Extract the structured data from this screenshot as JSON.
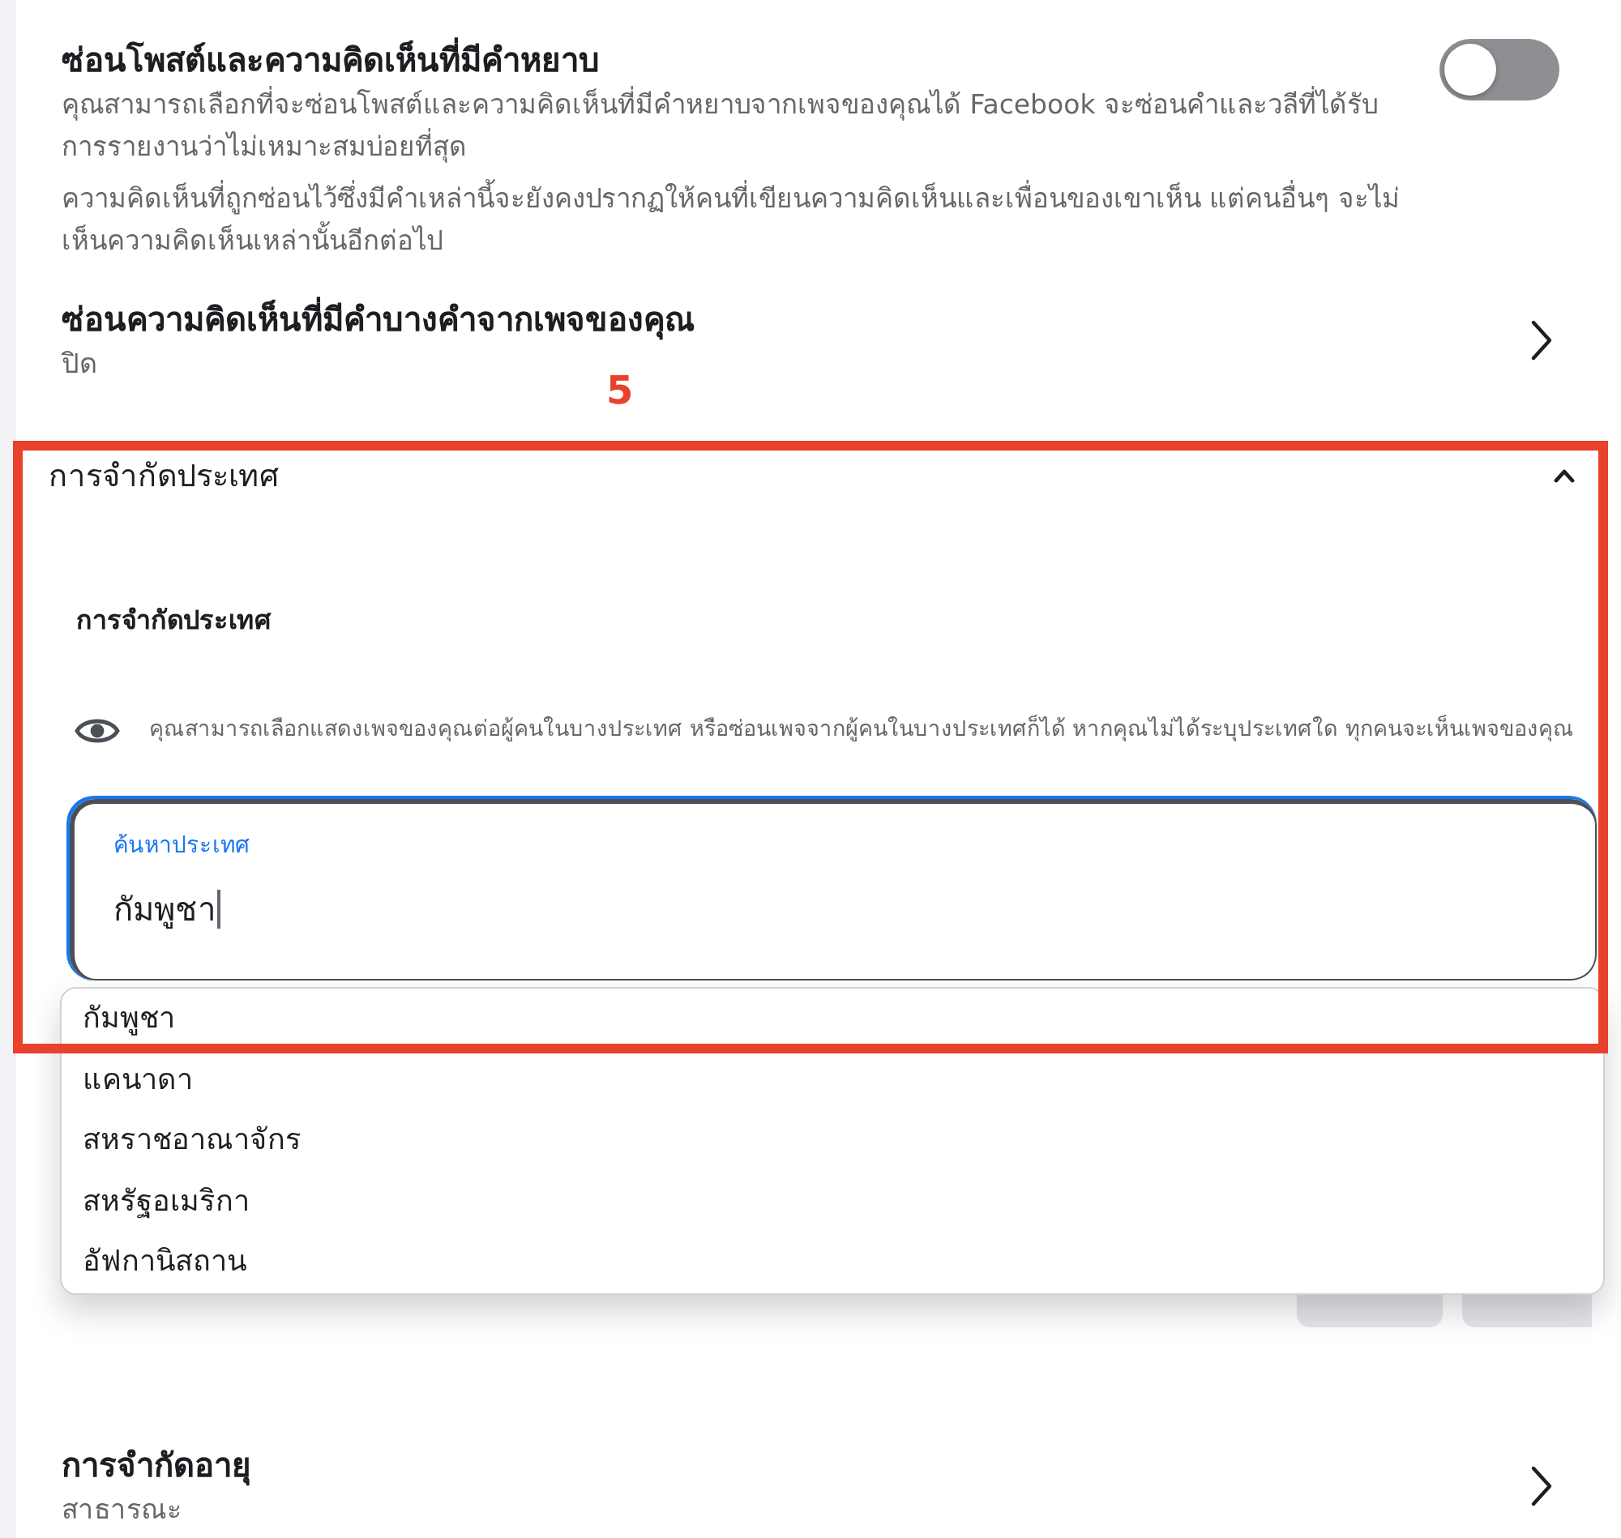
{
  "hide_profanity": {
    "title": "ซ่อนโพสต์และความคิดเห็นที่มีคำหยาบ",
    "description": [
      "คุณสามารถเลือกที่จะซ่อนโพสต์และความคิดเห็นที่มีคำหยาบจากเพจของคุณได้ Facebook จะซ่อนคำและวลีที่ได้รับการรายงานว่าไม่เหมาะสมบ่อยที่สุด",
      "ความคิดเห็นที่ถูกซ่อนไว้ซึ่งมีคำเหล่านี้จะยังคงปรากฏให้คนที่เขียนความคิดเห็นและเพื่อนของเขาเห็น แต่คนอื่นๆ จะไม่เห็นความคิดเห็นเหล่านั้นอีกต่อไป"
    ],
    "toggle": {
      "on": false
    }
  },
  "hide_words": {
    "title": "ซ่อนความคิดเห็นที่มีคำบางคำจากเพจของคุณ",
    "value": "ปิด"
  },
  "annotation": {
    "label": "5"
  },
  "country_restriction": {
    "header": "การจำกัดประเทศ",
    "expanded": true,
    "subheading": "การจำกัดประเทศ",
    "info": "คุณสามารถเลือกแสดงเพจของคุณต่อผู้คนในบางประเทศ หรือซ่อนเพจจากผู้คนในบางประเทศก็ได้ หากคุณไม่ได้ระบุประเทศใด ทุกคนจะเห็นเพจของคุณ",
    "search": {
      "label": "ค้นหาประเทศ",
      "value": "กัมพูชา",
      "focused": true
    },
    "suggestions": [
      {
        "label": "กัมพูชา"
      },
      {
        "label": "แคนาดา"
      },
      {
        "label": "สหราชอาณาจักร"
      },
      {
        "label": "สหรัฐอเมริกา"
      },
      {
        "label": "อัฟกานิสถาน"
      }
    ]
  },
  "age_restriction": {
    "title": "การจำกัดอายุ",
    "value": "สาธารณะ"
  }
}
